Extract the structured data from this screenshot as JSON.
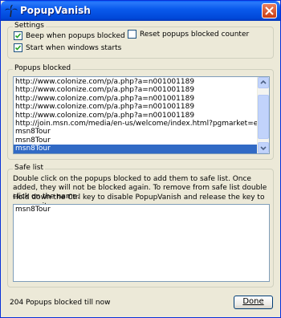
{
  "window": {
    "title": "PopupVanish"
  },
  "settings": {
    "legend": "Settings",
    "beep_label": "Beep when popups blocked",
    "beep_checked": true,
    "start_label": "Start when windows starts",
    "start_checked": true,
    "reset_label": "Reset popups blocked counter",
    "reset_checked": false
  },
  "popups": {
    "legend": "Popups blocked",
    "items": [
      "http://www.colonize.com/p/a.php?a=n001001189",
      "http://www.colonize.com/p/a.php?a=n001001189",
      "http://www.colonize.com/p/a.php?a=n001001189",
      "http://www.colonize.com/p/a.php?a=n001001189",
      "http://www.colonize.com/p/a.php?a=n001001189",
      "http://join.msn.com/media/en-us/welcome/index.html?pgmarket=en-us&RU=ht",
      "msn8Tour",
      "msn8Tour",
      "msn8Tour"
    ],
    "selected_index": 8
  },
  "safe": {
    "legend": "Safe list",
    "info1": "Double click on the popups blocked to add them to safe list. Once added, they will not be blocked again. To remove from safe list double click on the name.",
    "info2": "Hold down the Ctrl key to disable PopupVanish and release the key to resume it.",
    "items": [
      "msn8Tour"
    ]
  },
  "status": "204 Popups blocked till now",
  "done_label": "Done",
  "colors": {
    "title_bar": "#0a5bed",
    "selection": "#316ac5",
    "close_button": "#c93d13"
  }
}
